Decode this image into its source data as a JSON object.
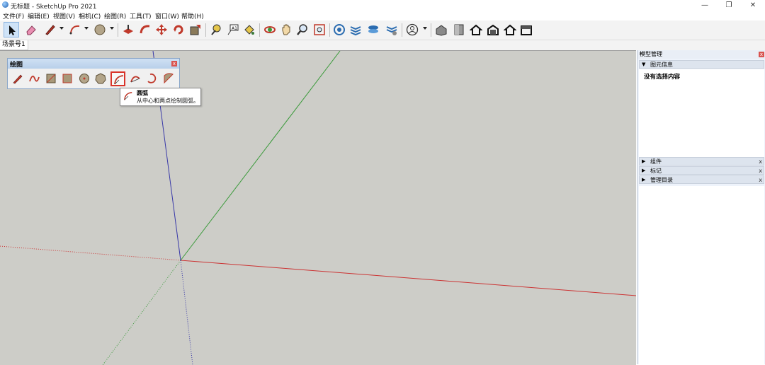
{
  "window": {
    "title": "无标题 - SketchUp Pro 2021",
    "minimize_glyph": "—",
    "restore_glyph": "❐",
    "close_glyph": "✕"
  },
  "menu": [
    "文件(F)",
    "编辑(E)",
    "视图(V)",
    "相机(C)",
    "绘图(R)",
    "工具(T)",
    "窗口(W)",
    "帮助(H)"
  ],
  "toolbar": {
    "tools": [
      "select-icon",
      "eraser-icon",
      "line-pencil-icon",
      "arc-icon",
      "shape-icon",
      "push-pull-icon",
      "follow-me-icon",
      "move-icon",
      "rotate-icon",
      "scale-icon",
      "tape-measure-icon",
      "text-icon",
      "paint-bucket-icon",
      "orbit-icon",
      "pan-icon",
      "zoom-icon",
      "zoom-extents-icon",
      "3d-warehouse-icon",
      "extension-warehouse-icon",
      "layout-icon",
      "extension-manager-icon",
      "user-account-icon",
      "iso-view-icon",
      "front-view-icon",
      "top-view-icon",
      "back-view-icon",
      "home-view-icon",
      "side-view-icon"
    ]
  },
  "scenes": {
    "tab_label": "场景号1"
  },
  "drawing_panel": {
    "title": "绘图",
    "close_glyph": "x",
    "tools": [
      "line-icon",
      "freehand-icon",
      "rectangle-icon",
      "rotated-rectangle-icon",
      "circle-icon",
      "polygon-icon",
      "arc-icon",
      "2-point-arc-icon",
      "3-point-arc-icon",
      "pie-icon"
    ],
    "selected_tool": "arc-icon"
  },
  "tooltip": {
    "title": "圆弧",
    "description": "从中心和两点绘制圆弧。"
  },
  "tray": {
    "title": "模型管理",
    "pin_glyph": "ᵖ",
    "close_glyph": "x",
    "sections": [
      {
        "label": "图元信息",
        "expanded": true
      },
      {
        "label": "组件",
        "expanded": false
      },
      {
        "label": "标记",
        "expanded": false
      },
      {
        "label": "管理目录",
        "expanded": false
      }
    ],
    "entity_info_text": "没有选择内容"
  },
  "colors": {
    "viewport": "#cdcdc8",
    "red_axis": "#cc3333",
    "green_axis": "#3a9a3a",
    "blue_axis": "#3838a8",
    "selected_border": "#d9342b"
  }
}
